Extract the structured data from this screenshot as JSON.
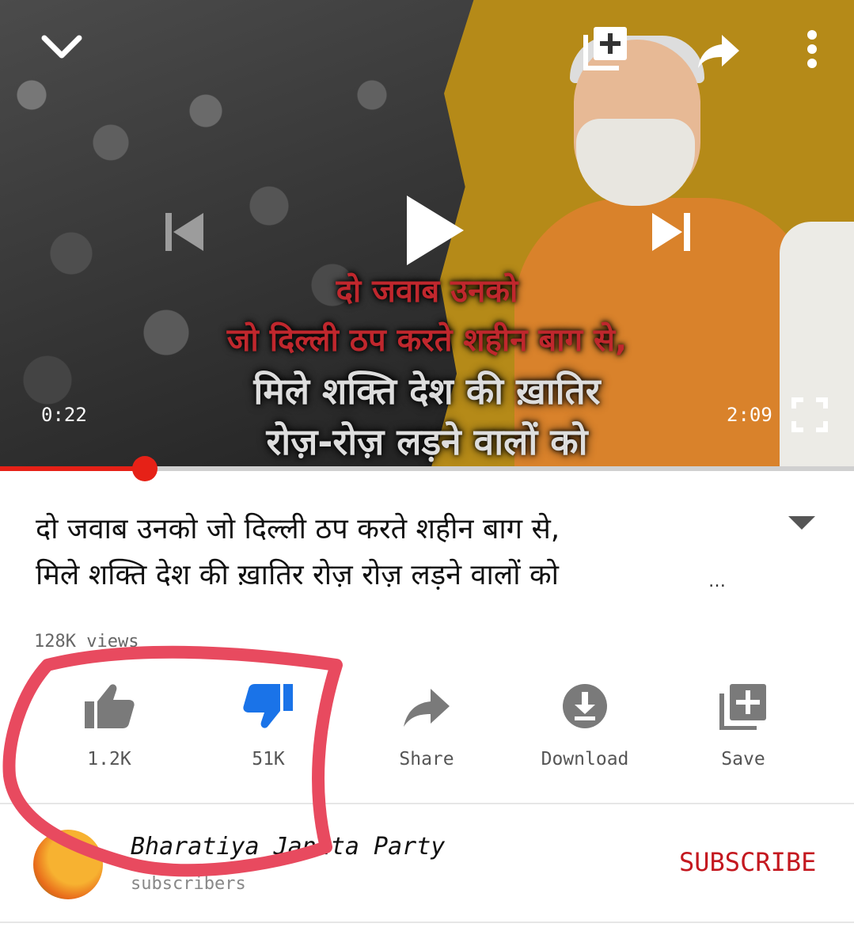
{
  "video": {
    "overlay_lines": [
      "दो जवाब उनको",
      "जो दिल्ली ठप करते शहीन बाग से,",
      "मिले शक्ति देश की ख़ातिर",
      "रोज़-रोज़ लड़ने वालों को"
    ],
    "current_time": "0:22",
    "duration": "2:09",
    "progress": 0.17
  },
  "details": {
    "title_line1": "दो जवाब उनको जो दिल्ली ठप करते शहीन बाग से,",
    "title_line2": "मिले शक्ति देश की ख़ातिर रोज़ रोज़ लड़ने वालों को",
    "ellipsis": "…",
    "views": "128K views"
  },
  "actions": {
    "like": "1.2K",
    "dislike": "51K",
    "share": "Share",
    "download": "Download",
    "save": "Save"
  },
  "channel": {
    "name": "Bharatiya Janata Party",
    "subscribers": "subscribers",
    "subscribe_label": "SUBSCRIBE"
  },
  "colors": {
    "accent_red": "#e62117",
    "dislike_blue": "#1a73e8",
    "annotation": "#e84a5f"
  },
  "icons": [
    "chevron-down-icon",
    "add-to-queue-icon",
    "share-icon",
    "more-vert-icon",
    "previous-icon",
    "play-icon",
    "next-icon",
    "fullscreen-icon",
    "thumb-up-icon",
    "thumb-down-icon",
    "download-icon",
    "save-icon"
  ]
}
